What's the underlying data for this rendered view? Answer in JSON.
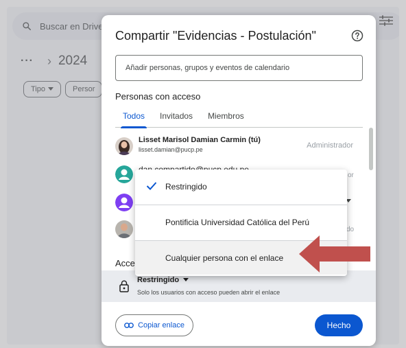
{
  "search": {
    "placeholder": "Buscar en Drive",
    "icon": "search-icon"
  },
  "breadcrumb": {
    "more": "···",
    "separator": "›",
    "year": "2024"
  },
  "filters": [
    {
      "label": "Tipo",
      "icon": "caret-down-icon"
    },
    {
      "label": "Persor"
    }
  ],
  "dialog": {
    "title": "Compartir \"Evidencias - Postulación\"",
    "add_placeholder": "Añadir personas, grupos y eventos de calendario",
    "people_title": "Personas con acceso",
    "tabs": [
      {
        "label": "Todos",
        "active": true
      },
      {
        "label": "Invitados"
      },
      {
        "label": "Miembros"
      }
    ],
    "people": [
      {
        "name": "Lisset Marisol Damian Carmin (tú)",
        "email": "lisset.damian@pucp.pe",
        "role": "Administrador"
      },
      {
        "name": "dan.compartido@pucp.edu.pe",
        "role_fragment": "or"
      }
    ],
    "row_fragment_do": "do",
    "general_access_label": "Acce",
    "general_access": {
      "selected": "Restringido",
      "description": "Solo los usuarios con acceso pueden abrir el enlace"
    },
    "copy_link_label": "Copiar enlace",
    "done_label": "Hecho"
  },
  "dropdown": {
    "items": [
      {
        "label": "Restringido",
        "checked": true
      },
      {
        "label": "Pontificia Universidad Católica del Perú"
      },
      {
        "label": "Cualquier persona con el enlace",
        "highlighted": true
      }
    ]
  },
  "colors": {
    "accent": "#0b57d0",
    "arrow": "#c0504d",
    "teal_avatar": "#26a69a",
    "purple_avatar": "#7e3ff2"
  }
}
